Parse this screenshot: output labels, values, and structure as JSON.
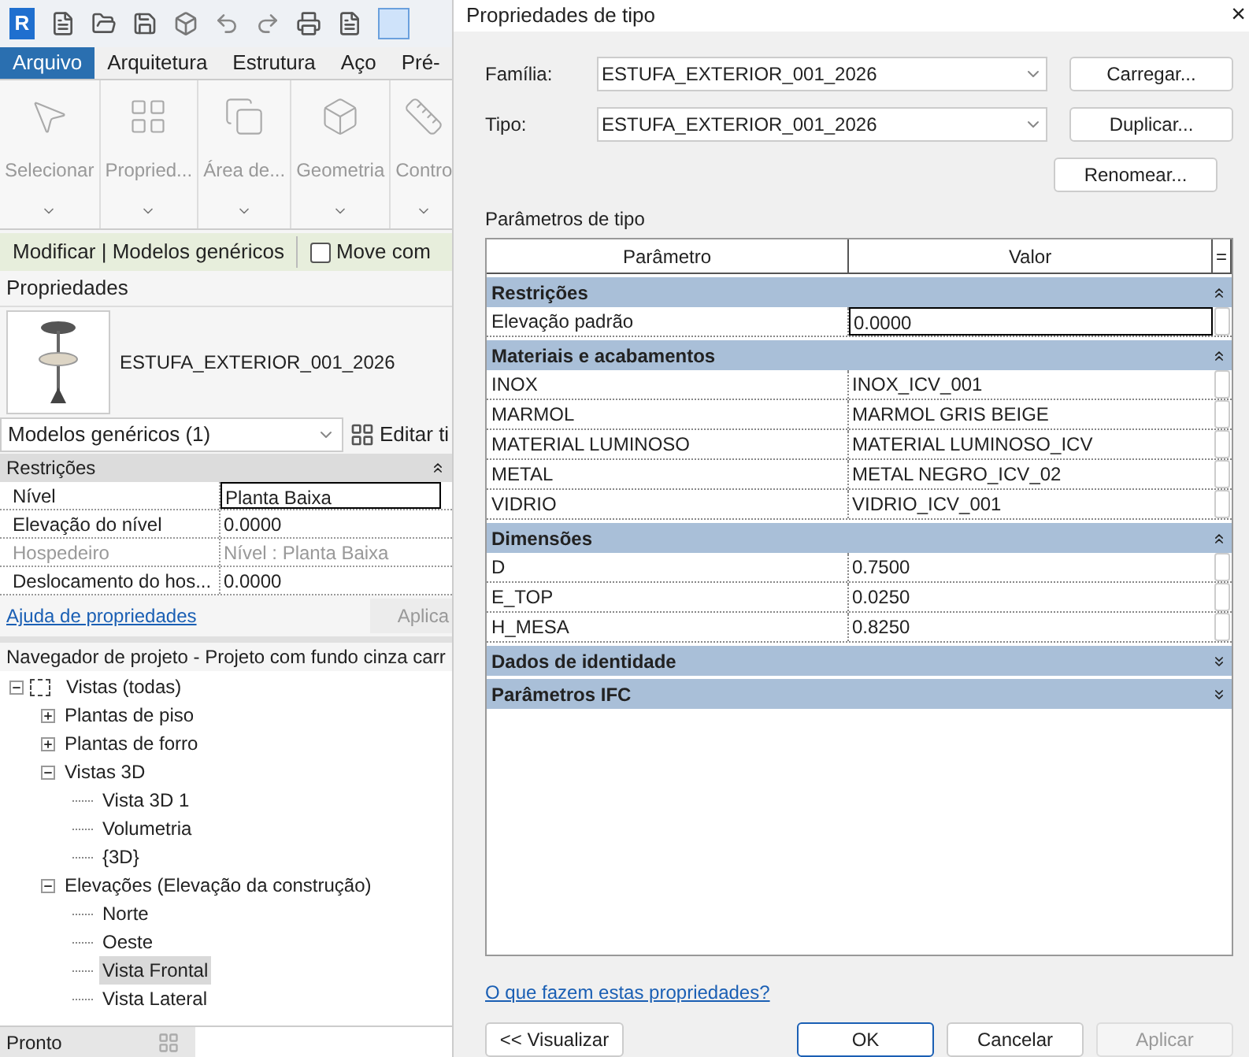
{
  "app": {
    "logo": "R",
    "ribbon": {
      "tabs": [
        {
          "label": "Arquivo",
          "selected": true
        },
        {
          "label": "Arquitetura",
          "selected": false
        },
        {
          "label": "Estrutura",
          "selected": false
        },
        {
          "label": "Aço",
          "selected": false
        },
        {
          "label": "Pré-",
          "selected": false
        }
      ],
      "panels": [
        {
          "label": "Selecionar",
          "kind": "select"
        },
        {
          "label": "Propried...",
          "kind": "properties"
        },
        {
          "label": "Área de...",
          "kind": "clipboard"
        },
        {
          "label": "Geometria",
          "kind": "geometry"
        },
        {
          "label": "Contro",
          "kind": "controls"
        }
      ]
    },
    "context_bar": {
      "label": "Modificar | Modelos genéricos",
      "checkbox": {
        "label": "Move com",
        "checked": false
      }
    },
    "properties": {
      "title": "Propriedades",
      "type_name": "ESTUFA_EXTERIOR_001_2026",
      "category": "Modelos genéricos (1)",
      "edit_type": "Editar ti",
      "section": {
        "name": "Restrições",
        "expanded": true
      },
      "rows": [
        {
          "name": "Nível",
          "value": "Planta Baixa",
          "disabled": false,
          "selected": true
        },
        {
          "name": "Elevação do nível",
          "value": "0.0000",
          "disabled": false,
          "selected": false
        },
        {
          "name": "Hospedeiro",
          "value": "Nível : Planta Baixa",
          "disabled": true,
          "selected": false
        },
        {
          "name": "Deslocamento do hos...",
          "value": "0.0000",
          "disabled": false,
          "selected": false
        }
      ],
      "help_link": "Ajuda de propriedades",
      "apply_button": "Aplica"
    },
    "project_browser": {
      "title": "Navegador de projeto - Projeto com fundo cinza carr",
      "tree": [
        {
          "label": "Vistas (todas)",
          "expanded": true,
          "selected": false,
          "children": [
            {
              "label": "Plantas de piso",
              "expanded": false,
              "selected": false
            },
            {
              "label": "Plantas de forro",
              "expanded": false,
              "selected": false
            },
            {
              "label": "Vistas 3D",
              "expanded": true,
              "selected": false,
              "children": [
                {
                  "label": "Vista 3D 1",
                  "selected": false
                },
                {
                  "label": "Volumetria",
                  "selected": false
                },
                {
                  "label": "{3D}",
                  "selected": false
                }
              ]
            },
            {
              "label": "Elevações (Elevação da construção)",
              "expanded": true,
              "selected": false,
              "children": [
                {
                  "label": "Norte",
                  "selected": false
                },
                {
                  "label": "Oeste",
                  "selected": false
                },
                {
                  "label": "Vista Frontal",
                  "selected": true
                },
                {
                  "label": "Vista Lateral",
                  "selected": false
                }
              ]
            }
          ]
        }
      ]
    },
    "status_bar": {
      "text": "Pronto"
    }
  },
  "dialog": {
    "title": "Propriedades de tipo",
    "close": "×",
    "fields": [
      {
        "label": "Família:",
        "value": "ESTUFA_EXTERIOR_001_2026",
        "button": "Carregar..."
      },
      {
        "label": "Tipo:",
        "value": "ESTUFA_EXTERIOR_001_2026",
        "button": "Duplicar..."
      }
    ],
    "rename_button": "Renomear...",
    "params_label": "Parâmetros de tipo",
    "table": {
      "columns": [
        "Parâmetro",
        "Valor",
        "="
      ],
      "groups": [
        {
          "name": "Restrições",
          "expanded": true,
          "rows": [
            {
              "name": "Elevação padrão",
              "value": "0.0000",
              "selected": true
            }
          ]
        },
        {
          "name": "Materiais e acabamentos",
          "expanded": true,
          "rows": [
            {
              "name": "INOX",
              "value": "INOX_ICV_001",
              "selected": false
            },
            {
              "name": "MARMOL",
              "value": "MARMOL GRIS BEIGE",
              "selected": false
            },
            {
              "name": "MATERIAL LUMINOSO",
              "value": "MATERIAL LUMINOSO_ICV",
              "selected": false
            },
            {
              "name": "METAL",
              "value": "METAL NEGRO_ICV_02",
              "selected": false
            },
            {
              "name": "VIDRIO",
              "value": "VIDRIO_ICV_001",
              "selected": false
            }
          ]
        },
        {
          "name": "Dimensões",
          "expanded": true,
          "rows": [
            {
              "name": "D",
              "value": "0.7500",
              "selected": false
            },
            {
              "name": "E_TOP",
              "value": "0.0250",
              "selected": false
            },
            {
              "name": "H_MESA",
              "value": "0.8250",
              "selected": false
            }
          ]
        },
        {
          "name": "Dados de identidade",
          "expanded": false
        },
        {
          "name": "Parâmetros IFC",
          "expanded": false
        }
      ]
    },
    "help_link": "O que fazem estas propriedades?",
    "preview_button": "<< Visualizar",
    "buttons": [
      {
        "label": "OK",
        "default": true,
        "disabled": false
      },
      {
        "label": "Cancelar",
        "default": false,
        "disabled": false
      },
      {
        "label": "Aplicar",
        "default": false,
        "disabled": true
      }
    ]
  }
}
